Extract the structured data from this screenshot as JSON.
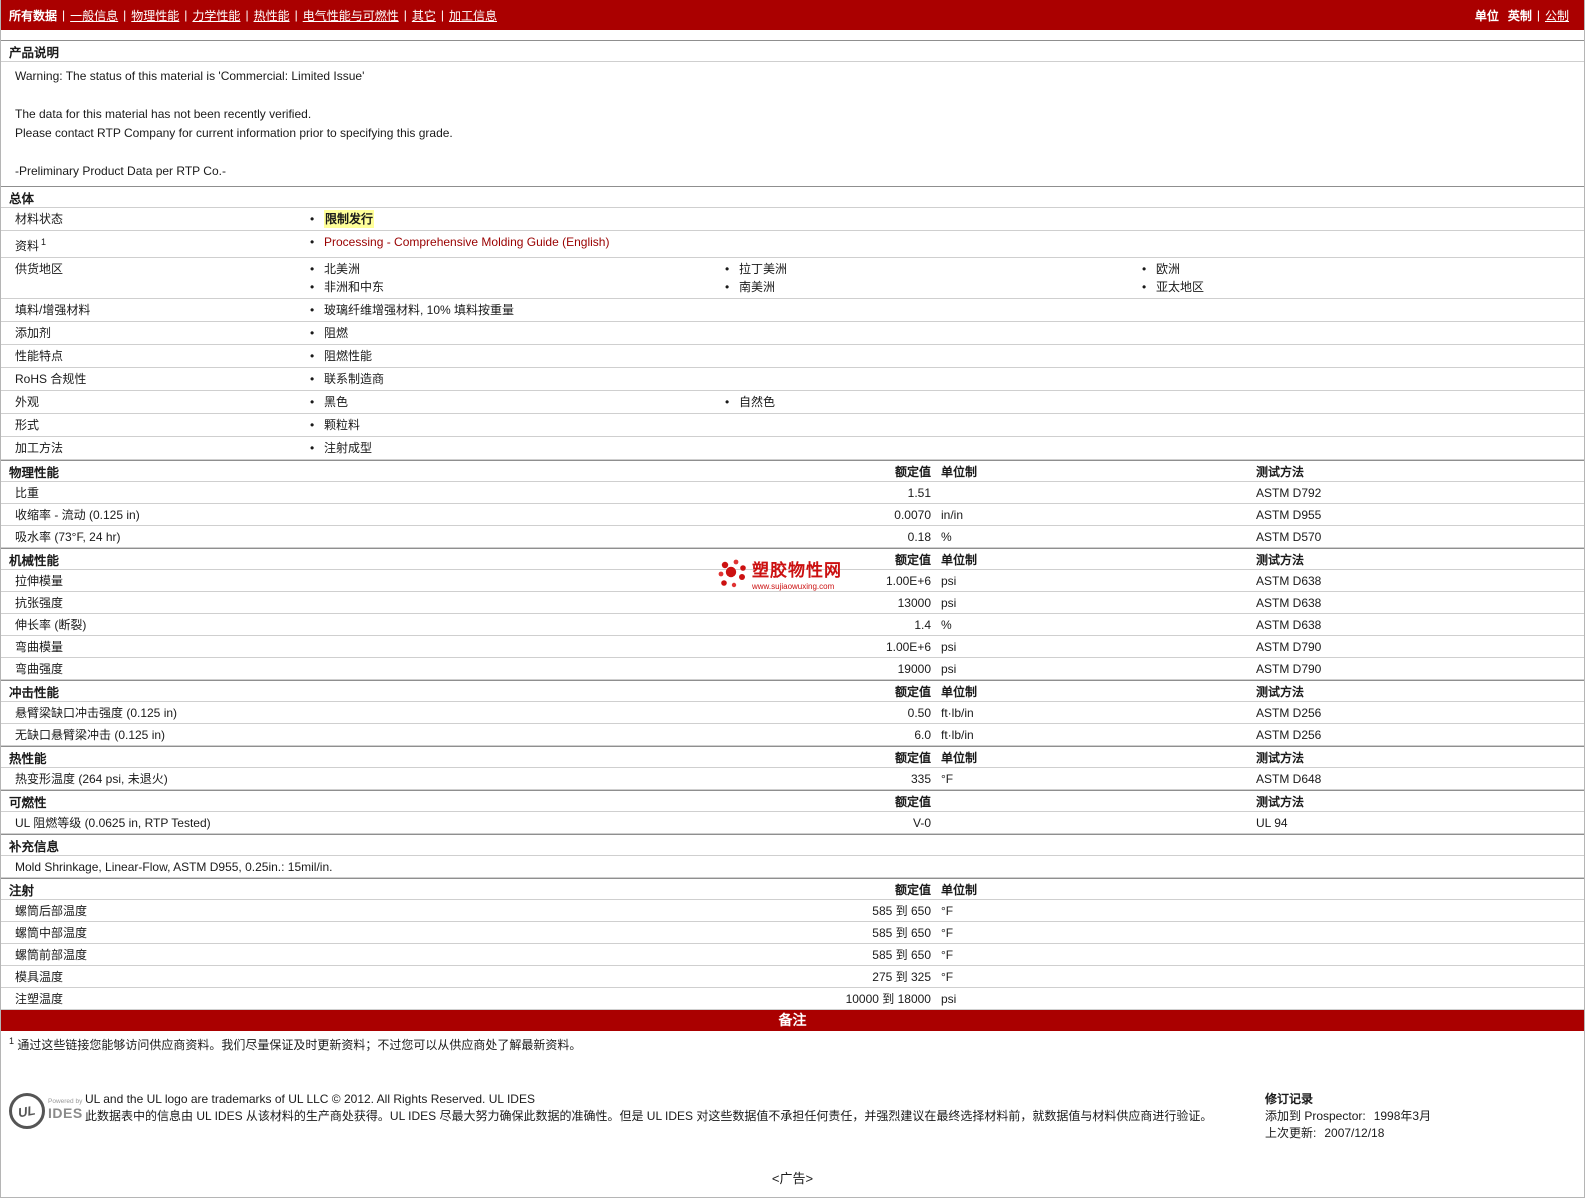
{
  "colors": {
    "accent_red": "#aa0000",
    "highlight_yellow": "#ffff99",
    "link_red": "#990000",
    "watermark_red": "#cc1111"
  },
  "nav": {
    "items": [
      "所有数据",
      "一般信息",
      "物理性能",
      "力学性能",
      "热性能",
      "电气性能与可燃性",
      "其它",
      "加工信息"
    ],
    "active_item": "所有数据",
    "units_label": "单位",
    "units": [
      "英制",
      "公制"
    ],
    "active_unit": "英制"
  },
  "product_description": {
    "title": "产品说明",
    "lines": [
      "Warning: The status of this material is 'Commercial: Limited Issue'",
      "",
      "The data for this material has not been recently verified.",
      "Please contact RTP Company for current information prior to specifying this grade.",
      "",
      "-Preliminary Product Data per RTP Co.-"
    ]
  },
  "general": {
    "title": "总体",
    "rows": [
      {
        "label": "材料状态",
        "style": "highlight",
        "cols": [
          [
            "限制发行"
          ],
          [],
          []
        ]
      },
      {
        "label": "资料",
        "sup": "1",
        "style": "link",
        "cols": [
          [
            "Processing - Comprehensive Molding Guide (English)"
          ],
          [],
          []
        ]
      },
      {
        "label": "供货地区",
        "cols": [
          [
            "北美洲",
            "非洲和中东"
          ],
          [
            "拉丁美洲",
            "南美洲"
          ],
          [
            "欧洲",
            "亚太地区"
          ]
        ]
      },
      {
        "label": "填料/增强材料",
        "cols": [
          [
            "玻璃纤维增强材料, 10% 填料按重量"
          ],
          [],
          []
        ]
      },
      {
        "label": "添加剂",
        "cols": [
          [
            "阻燃"
          ],
          [],
          []
        ]
      },
      {
        "label": "性能特点",
        "cols": [
          [
            "阻燃性能"
          ],
          [],
          []
        ]
      },
      {
        "label": "RoHS 合规性",
        "cols": [
          [
            "联系制造商"
          ],
          [],
          []
        ]
      },
      {
        "label": "外观",
        "cols": [
          [
            "黑色"
          ],
          [
            "自然色"
          ],
          []
        ]
      },
      {
        "label": "形式",
        "cols": [
          [
            "颗粒料"
          ],
          [],
          []
        ]
      },
      {
        "label": "加工方法",
        "cols": [
          [
            "注射成型"
          ],
          [],
          []
        ]
      }
    ]
  },
  "property_sections": [
    {
      "title": "物理性能",
      "value_header": "额定值",
      "unit_header": "单位制",
      "method_header": "测试方法",
      "rows": [
        {
          "label": "比重",
          "value": "1.51",
          "unit": "",
          "method": "ASTM D792"
        },
        {
          "label": "收缩率 - 流动 (0.125 in)",
          "value": "0.0070",
          "unit": "in/in",
          "method": "ASTM D955"
        },
        {
          "label": "吸水率 (73°F, 24 hr)",
          "value": "0.18",
          "unit": "%",
          "method": "ASTM D570"
        }
      ]
    },
    {
      "title": "机械性能",
      "value_header": "额定值",
      "unit_header": "单位制",
      "method_header": "测试方法",
      "rows": [
        {
          "label": "拉伸模量",
          "value": "1.00E+6",
          "unit": "psi",
          "method": "ASTM D638"
        },
        {
          "label": "抗张强度",
          "value": "13000",
          "unit": "psi",
          "method": "ASTM D638"
        },
        {
          "label": "伸长率 (断裂)",
          "value": "1.4",
          "unit": "%",
          "method": "ASTM D638"
        },
        {
          "label": "弯曲模量",
          "value": "1.00E+6",
          "unit": "psi",
          "method": "ASTM D790"
        },
        {
          "label": "弯曲强度",
          "value": "19000",
          "unit": "psi",
          "method": "ASTM D790"
        }
      ]
    },
    {
      "title": "冲击性能",
      "value_header": "额定值",
      "unit_header": "单位制",
      "method_header": "测试方法",
      "rows": [
        {
          "label": "悬臂梁缺口冲击强度 (0.125 in)",
          "value": "0.50",
          "unit": "ft·lb/in",
          "method": "ASTM D256"
        },
        {
          "label": "无缺口悬臂梁冲击 (0.125 in)",
          "value": "6.0",
          "unit": "ft·lb/in",
          "method": "ASTM D256"
        }
      ]
    },
    {
      "title": "热性能",
      "value_header": "额定值",
      "unit_header": "单位制",
      "method_header": "测试方法",
      "rows": [
        {
          "label": "热变形温度 (264 psi, 未退火)",
          "value": "335",
          "unit": "°F",
          "method": "ASTM D648"
        }
      ]
    },
    {
      "title": "可燃性",
      "value_header": "额定值",
      "unit_header": "",
      "method_header": "测试方法",
      "rows": [
        {
          "label": "UL 阻燃等级 (0.0625 in, RTP Tested)",
          "value": "V-0",
          "unit": "",
          "method": "UL 94"
        }
      ]
    }
  ],
  "supplemental": {
    "title": "补充信息",
    "text": "Mold Shrinkage, Linear-Flow, ASTM D955, 0.25in.: 15mil/in."
  },
  "injection": {
    "title": "注射",
    "value_header": "额定值",
    "unit_header": "单位制",
    "method_header": "",
    "rows": [
      {
        "label": "螺筒后部温度",
        "value": "585 到  650",
        "unit": "°F",
        "method": ""
      },
      {
        "label": "螺筒中部温度",
        "value": "585 到  650",
        "unit": "°F",
        "method": ""
      },
      {
        "label": "螺筒前部温度",
        "value": "585 到  650",
        "unit": "°F",
        "method": ""
      },
      {
        "label": "模具温度",
        "value": "275 到  325",
        "unit": "°F",
        "method": ""
      },
      {
        "label": "注塑温度",
        "value": "10000 到  18000",
        "unit": "psi",
        "method": ""
      }
    ]
  },
  "notes": {
    "banner": "备注",
    "footnote_sup": "1",
    "footnote": "通过这些链接您能够访问供应商资料。我们尽量保证及时更新资料；不过您可以从供应商处了解最新资料。"
  },
  "watermark": {
    "name": "塑胶物性网",
    "url": "www.sujiaowuxing.com"
  },
  "footer": {
    "logo_ul": "UL",
    "logo_powered": "Powered by",
    "logo_ides": "IDES",
    "trademark": "UL and the UL logo are trademarks of UL LLC © 2012. All Rights Reserved. UL IDES",
    "disclaimer": "此数据表中的信息由  UL IDES 从该材料的生产商处获得。UL IDES 尽最大努力确保此数据的准确性。但是  UL IDES 对这些数据值不承担任何责任，并强烈建议在最终选择材料前，就数据值与材料供应商进行验证。",
    "revision_title": "修订记录",
    "added_label": "添加到  Prospector:",
    "added_value": "1998年3月",
    "updated_label": "上次更新:",
    "updated_value": "2007/12/18"
  },
  "ad": "<广告>"
}
